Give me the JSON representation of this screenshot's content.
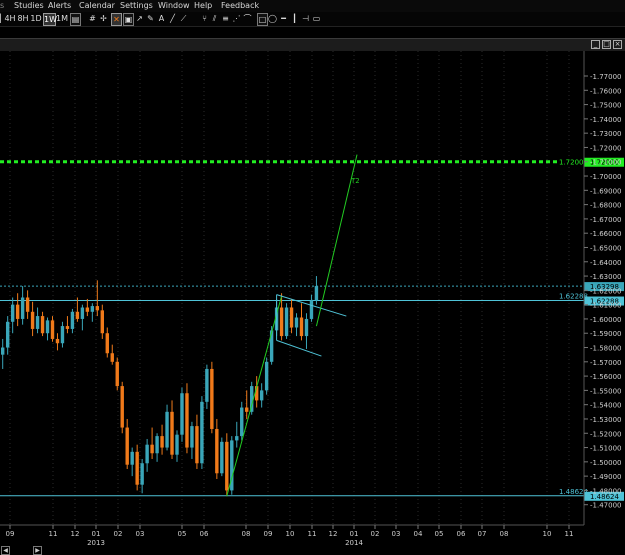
{
  "menu": [
    "Studies",
    "Alerts",
    "Calendar",
    "Settings",
    "Window",
    "Help",
    "Feedback"
  ],
  "toolbar": {
    "timeframes": [
      "4H",
      "8H",
      "1D",
      "1W",
      "1M"
    ],
    "active_timeframe": "1W"
  },
  "chart": {
    "symbol_price_current": "1.63298",
    "y_axis": {
      "min": 1.47,
      "max": 1.78,
      "step": 0.01,
      "labels": [
        "1.77000",
        "1.76000",
        "1.75000",
        "1.74000",
        "1.73000",
        "1.72000",
        "1.71000",
        "1.70000",
        "1.69000",
        "1.68000",
        "1.67000",
        "1.66000",
        "1.65000",
        "1.64000",
        "1.63000",
        "1.62000",
        "1.61000",
        "1.60000",
        "1.59000",
        "1.58000",
        "1.57000",
        "1.56000",
        "1.55000",
        "1.54000",
        "1.53000",
        "1.52000",
        "1.51000",
        "1.50000",
        "1.49000",
        "1.48000",
        "1.47000"
      ]
    },
    "x_axis": {
      "month_labels": [
        "09",
        "11",
        "12",
        "01",
        "02",
        "03",
        "05",
        "06",
        "08",
        "09",
        "10",
        "11",
        "12",
        "01",
        "02",
        "03",
        "04",
        "05",
        "06",
        "07",
        "08",
        "10",
        "11"
      ],
      "year_labels": [
        "2013",
        "2014"
      ]
    },
    "horizontal_levels": [
      {
        "label": "1.72000",
        "value": 1.72,
        "color": "#22ee22",
        "style": "dashed"
      },
      {
        "label": "1.62288",
        "value": 1.62288,
        "color": "#4fc3d7",
        "style": "solid"
      },
      {
        "label": "1.48624",
        "value": 1.48624,
        "color": "#4fc3d7",
        "style": "solid"
      }
    ],
    "projection_label": "T2",
    "colors": {
      "up": "#3aa6b9",
      "down": "#f07a1a",
      "target": "#22ee22",
      "support": "#4fc3d7",
      "grid": "#2a2a2a"
    }
  }
}
